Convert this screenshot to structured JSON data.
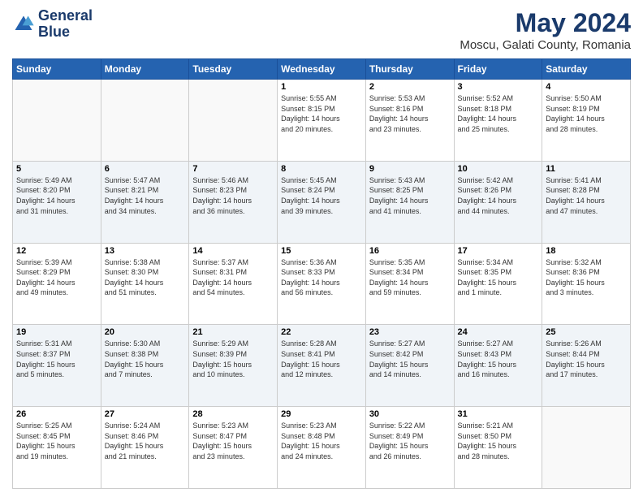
{
  "header": {
    "logo_line1": "General",
    "logo_line2": "Blue",
    "title": "May 2024",
    "subtitle": "Moscu, Galati County, Romania"
  },
  "days_of_week": [
    "Sunday",
    "Monday",
    "Tuesday",
    "Wednesday",
    "Thursday",
    "Friday",
    "Saturday"
  ],
  "weeks": [
    [
      {
        "day": "",
        "info": ""
      },
      {
        "day": "",
        "info": ""
      },
      {
        "day": "",
        "info": ""
      },
      {
        "day": "1",
        "info": "Sunrise: 5:55 AM\nSunset: 8:15 PM\nDaylight: 14 hours\nand 20 minutes."
      },
      {
        "day": "2",
        "info": "Sunrise: 5:53 AM\nSunset: 8:16 PM\nDaylight: 14 hours\nand 23 minutes."
      },
      {
        "day": "3",
        "info": "Sunrise: 5:52 AM\nSunset: 8:18 PM\nDaylight: 14 hours\nand 25 minutes."
      },
      {
        "day": "4",
        "info": "Sunrise: 5:50 AM\nSunset: 8:19 PM\nDaylight: 14 hours\nand 28 minutes."
      }
    ],
    [
      {
        "day": "5",
        "info": "Sunrise: 5:49 AM\nSunset: 8:20 PM\nDaylight: 14 hours\nand 31 minutes."
      },
      {
        "day": "6",
        "info": "Sunrise: 5:47 AM\nSunset: 8:21 PM\nDaylight: 14 hours\nand 34 minutes."
      },
      {
        "day": "7",
        "info": "Sunrise: 5:46 AM\nSunset: 8:23 PM\nDaylight: 14 hours\nand 36 minutes."
      },
      {
        "day": "8",
        "info": "Sunrise: 5:45 AM\nSunset: 8:24 PM\nDaylight: 14 hours\nand 39 minutes."
      },
      {
        "day": "9",
        "info": "Sunrise: 5:43 AM\nSunset: 8:25 PM\nDaylight: 14 hours\nand 41 minutes."
      },
      {
        "day": "10",
        "info": "Sunrise: 5:42 AM\nSunset: 8:26 PM\nDaylight: 14 hours\nand 44 minutes."
      },
      {
        "day": "11",
        "info": "Sunrise: 5:41 AM\nSunset: 8:28 PM\nDaylight: 14 hours\nand 47 minutes."
      }
    ],
    [
      {
        "day": "12",
        "info": "Sunrise: 5:39 AM\nSunset: 8:29 PM\nDaylight: 14 hours\nand 49 minutes."
      },
      {
        "day": "13",
        "info": "Sunrise: 5:38 AM\nSunset: 8:30 PM\nDaylight: 14 hours\nand 51 minutes."
      },
      {
        "day": "14",
        "info": "Sunrise: 5:37 AM\nSunset: 8:31 PM\nDaylight: 14 hours\nand 54 minutes."
      },
      {
        "day": "15",
        "info": "Sunrise: 5:36 AM\nSunset: 8:33 PM\nDaylight: 14 hours\nand 56 minutes."
      },
      {
        "day": "16",
        "info": "Sunrise: 5:35 AM\nSunset: 8:34 PM\nDaylight: 14 hours\nand 59 minutes."
      },
      {
        "day": "17",
        "info": "Sunrise: 5:34 AM\nSunset: 8:35 PM\nDaylight: 15 hours\nand 1 minute."
      },
      {
        "day": "18",
        "info": "Sunrise: 5:32 AM\nSunset: 8:36 PM\nDaylight: 15 hours\nand 3 minutes."
      }
    ],
    [
      {
        "day": "19",
        "info": "Sunrise: 5:31 AM\nSunset: 8:37 PM\nDaylight: 15 hours\nand 5 minutes."
      },
      {
        "day": "20",
        "info": "Sunrise: 5:30 AM\nSunset: 8:38 PM\nDaylight: 15 hours\nand 7 minutes."
      },
      {
        "day": "21",
        "info": "Sunrise: 5:29 AM\nSunset: 8:39 PM\nDaylight: 15 hours\nand 10 minutes."
      },
      {
        "day": "22",
        "info": "Sunrise: 5:28 AM\nSunset: 8:41 PM\nDaylight: 15 hours\nand 12 minutes."
      },
      {
        "day": "23",
        "info": "Sunrise: 5:27 AM\nSunset: 8:42 PM\nDaylight: 15 hours\nand 14 minutes."
      },
      {
        "day": "24",
        "info": "Sunrise: 5:27 AM\nSunset: 8:43 PM\nDaylight: 15 hours\nand 16 minutes."
      },
      {
        "day": "25",
        "info": "Sunrise: 5:26 AM\nSunset: 8:44 PM\nDaylight: 15 hours\nand 17 minutes."
      }
    ],
    [
      {
        "day": "26",
        "info": "Sunrise: 5:25 AM\nSunset: 8:45 PM\nDaylight: 15 hours\nand 19 minutes."
      },
      {
        "day": "27",
        "info": "Sunrise: 5:24 AM\nSunset: 8:46 PM\nDaylight: 15 hours\nand 21 minutes."
      },
      {
        "day": "28",
        "info": "Sunrise: 5:23 AM\nSunset: 8:47 PM\nDaylight: 15 hours\nand 23 minutes."
      },
      {
        "day": "29",
        "info": "Sunrise: 5:23 AM\nSunset: 8:48 PM\nDaylight: 15 hours\nand 24 minutes."
      },
      {
        "day": "30",
        "info": "Sunrise: 5:22 AM\nSunset: 8:49 PM\nDaylight: 15 hours\nand 26 minutes."
      },
      {
        "day": "31",
        "info": "Sunrise: 5:21 AM\nSunset: 8:50 PM\nDaylight: 15 hours\nand 28 minutes."
      },
      {
        "day": "",
        "info": ""
      }
    ]
  ]
}
